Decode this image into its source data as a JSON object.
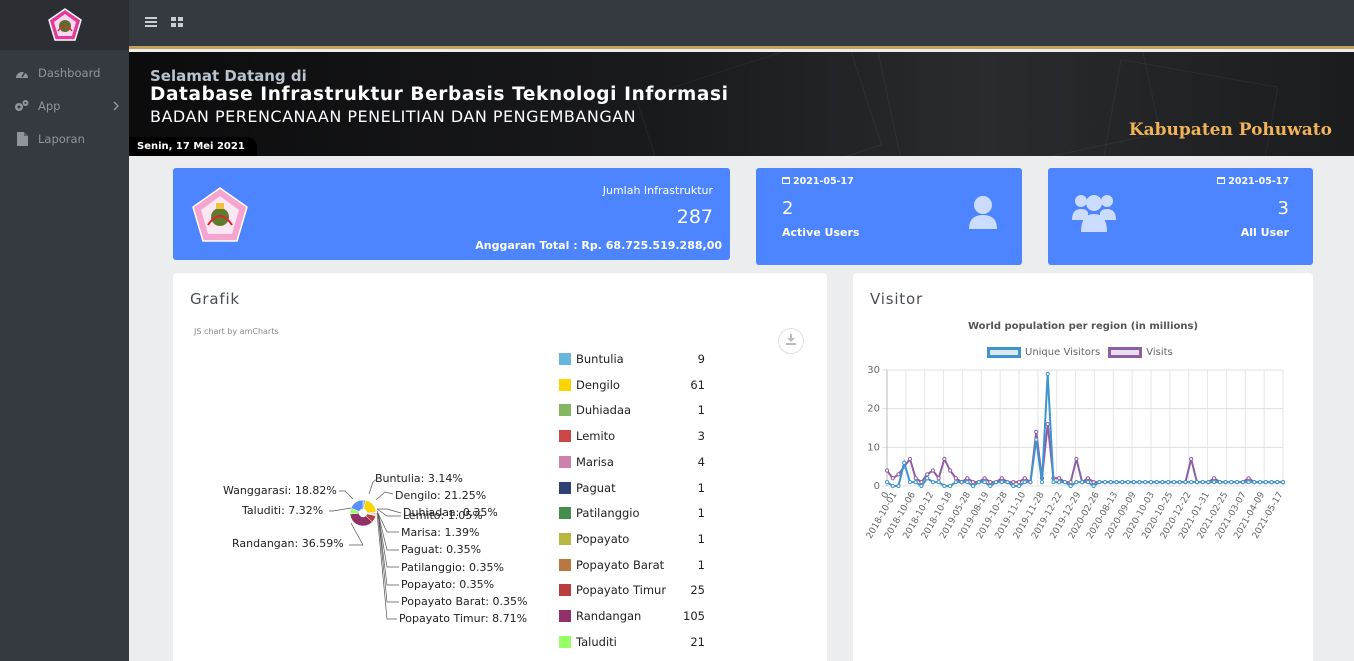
{
  "sidebar": {
    "items": [
      {
        "label": "Dashboard",
        "icon": "dashboard-icon"
      },
      {
        "label": "App",
        "icon": "app-icon"
      },
      {
        "label": "Laporan",
        "icon": "report-icon"
      }
    ]
  },
  "banner": {
    "welcome": "Selamat Datang di",
    "title": "Database Infrastruktur Berbasis Teknologi Informasi",
    "subtitle": "BADAN PERENCANAAN PENELITIAN DAN PENGEMBANGAN",
    "region": "Kabupaten Pohuwato",
    "date": "Senin, 17 Mei 2021"
  },
  "stats": {
    "infra_label": "Jumlah Infrastruktur",
    "infra_value": "287",
    "budget": "Anggaran Total : Rp. 68.725.519.288,00",
    "active_date": "2021-05-17",
    "active_value": "2",
    "active_label": "Active Users",
    "all_date": "2021-05-17",
    "all_value": "3",
    "all_label": "All User"
  },
  "grafik": {
    "title": "Grafik",
    "credit": "JS chart by amCharts",
    "legend": [
      {
        "name": "Buntulia",
        "value": "9",
        "color": "#67b7dc"
      },
      {
        "name": "Dengilo",
        "value": "61",
        "color": "#fdd400"
      },
      {
        "name": "Duhiadaa",
        "value": "1",
        "color": "#84b761"
      },
      {
        "name": "Lemito",
        "value": "3",
        "color": "#cc4748"
      },
      {
        "name": "Marisa",
        "value": "4",
        "color": "#cd82ad"
      },
      {
        "name": "Paguat",
        "value": "1",
        "color": "#2f4074"
      },
      {
        "name": "Patilanggio",
        "value": "1",
        "color": "#448e4d"
      },
      {
        "name": "Popayato",
        "value": "1",
        "color": "#b7b83f"
      },
      {
        "name": "Popayato Barat",
        "value": "1",
        "color": "#b9783f"
      },
      {
        "name": "Popayato Timur",
        "value": "25",
        "color": "#b93e3d"
      },
      {
        "name": "Randangan",
        "value": "105",
        "color": "#913167"
      },
      {
        "name": "Taluditi",
        "value": "21",
        "color": "#99ff66"
      }
    ],
    "pie_labels": [
      "Buntulia: 3.14%",
      "Dengilo: 21.25%",
      "Duhiadaa: 0.35%",
      "Lemito: 1.05%",
      "Marisa: 1.39%",
      "Paguat: 0.35%",
      "Patilanggio: 0.35%",
      "Popayato: 0.35%",
      "Popayato Barat: 0.35%",
      "Popayato Timur: 8.71%",
      "Randangan: 36.59%",
      "Taluditi: 7.32%",
      "Wanggarasi: 18.82%"
    ]
  },
  "visitor": {
    "title": "Visitor",
    "chart_title": "World population per region (in millions)",
    "legend": [
      "Unique Visitors",
      "Visits"
    ]
  },
  "chart_data": [
    {
      "type": "pie",
      "title": "",
      "categories": [
        "Buntulia",
        "Dengilo",
        "Duhiadaa",
        "Lemito",
        "Marisa",
        "Paguat",
        "Patilanggio",
        "Popayato",
        "Popayato Barat",
        "Popayato Timur",
        "Randangan",
        "Taluditi",
        "Wanggarasi"
      ],
      "values": [
        9,
        61,
        1,
        3,
        4,
        1,
        1,
        1,
        1,
        25,
        105,
        21,
        54
      ],
      "colors": [
        "#67b7dc",
        "#fdd400",
        "#84b761",
        "#cc4748",
        "#cd82ad",
        "#2f4074",
        "#448e4d",
        "#b7b83f",
        "#b9783f",
        "#b93e3d",
        "#913167",
        "#99ff66",
        "#5b8ff9"
      ]
    },
    {
      "type": "line",
      "title": "World population per region (in millions)",
      "x": [
        "2018-10-01",
        "2018-10-06",
        "2018-10-12",
        "2018-10-18",
        "2019-05-28",
        "2019-08-19",
        "2019-10-28",
        "2019-11-10",
        "2019-11-28",
        "2019-12-22",
        "2019-12-29",
        "2020-02-26",
        "2020-08-13",
        "2020-09-09",
        "2020-10-03",
        "2020-10-25",
        "2020-12-22",
        "2021-01-31",
        "2021-02-25",
        "2021-03-07",
        "2021-04-09",
        "2021-05-17"
      ],
      "ylim": [
        0,
        30
      ],
      "yticks": [
        0,
        10,
        20,
        30
      ],
      "grid": true,
      "legend_position": "top",
      "series": [
        {
          "name": "Unique Visitors",
          "color": "#3e95cd",
          "values": [
            1,
            0,
            0,
            6,
            1,
            1,
            0,
            2,
            1,
            1,
            0,
            0,
            1,
            1,
            1,
            0,
            1,
            1,
            0,
            1,
            1,
            1,
            0,
            0,
            1,
            1,
            12,
            1,
            29,
            1,
            1,
            1,
            0,
            1,
            1,
            1,
            0,
            1,
            1,
            1,
            1,
            1,
            1,
            1,
            1,
            1,
            1,
            1,
            1,
            1,
            1,
            1,
            1,
            1,
            1,
            1,
            1,
            1,
            1,
            1,
            1,
            1,
            1,
            1,
            1,
            1,
            1,
            1,
            1,
            1
          ]
        },
        {
          "name": "Visits",
          "color": "#8e5ea2",
          "values": [
            4,
            2,
            3,
            5,
            7,
            2,
            1,
            3,
            4,
            2,
            7,
            4,
            2,
            1,
            2,
            1,
            1,
            2,
            1,
            1,
            2,
            1,
            1,
            1,
            2,
            1,
            14,
            2,
            16,
            2,
            2,
            1,
            1,
            7,
            1,
            2,
            1,
            1,
            1,
            1,
            1,
            1,
            1,
            1,
            1,
            1,
            1,
            1,
            1,
            1,
            1,
            1,
            1,
            7,
            1,
            1,
            1,
            2,
            1,
            1,
            1,
            1,
            1,
            2,
            1,
            1,
            1,
            1,
            1,
            1
          ]
        }
      ]
    }
  ]
}
